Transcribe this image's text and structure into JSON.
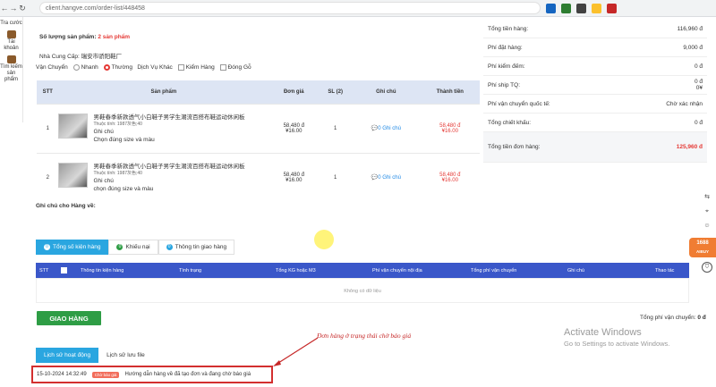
{
  "browser": {
    "url": "client.hangve.com/order-list/448458"
  },
  "sidebar": {
    "items": [
      {
        "label": "Tra cước"
      },
      {
        "label": "Tài khoản"
      },
      {
        "label": "Tìm kiếm sản phẩm"
      }
    ]
  },
  "order": {
    "qty_label": "Số lượng sản phẩm:",
    "qty_value": "2 sản phẩm",
    "supplier_label": "Nhà Cung Cấp:",
    "supplier_value": "瑞安市骄阳鞋厂",
    "shipping_label": "Vận Chuyển",
    "shipping_options": [
      "Nhanh",
      "Thường"
    ],
    "service_label": "Dịch Vụ Khác",
    "service_options": [
      "Kiểm Hàng",
      "Đóng Gỗ"
    ],
    "note_label": "Ghi chú cho Hàng về:"
  },
  "products_table": {
    "headers": [
      "STT",
      "Sản phẩm",
      "Đơn giá",
      "SL (2)",
      "Ghi chú",
      "Thành tiền"
    ],
    "rows": [
      {
        "stt": "1",
        "name": "男鞋春季新款透气小白鞋子男学生潮流百搭布鞋运动休闲板",
        "attr": "Thuộc tính: 1987灰色;40",
        "note": "Ghi chú",
        "link": "Chọn đúng size và màu",
        "price_vnd": "58,480 đ",
        "price_cny": "¥16.00",
        "qty": "1",
        "note_btn": "0 Ghi chú",
        "total_vnd": "58,480 đ",
        "total_cny": "¥16.00"
      },
      {
        "stt": "2",
        "name": "男鞋春季新款透气小白鞋子男学生潮流百搭布鞋运动休闲板",
        "attr": "Thuộc tính: 1987灰色;40",
        "note": "Ghi chú",
        "link": "chọn đúng size và màu",
        "price_vnd": "58,480 đ",
        "price_cny": "¥16.00",
        "qty": "1",
        "note_btn": "0 Ghi chú",
        "total_vnd": "58,480 đ",
        "total_cny": "¥16.00"
      }
    ]
  },
  "summary": {
    "rows": [
      {
        "label": "Tổng tiền hàng:",
        "value": "116,960 đ"
      },
      {
        "label": "Phí đặt hàng:",
        "value": "9,000 đ"
      },
      {
        "label": "Phí kiểm đếm:",
        "value": "0 đ"
      },
      {
        "label": "Phí ship TQ:",
        "value": "0 đ",
        "value2": "0¥"
      },
      {
        "label": "Phí vận chuyển quốc tế:",
        "value": "Chờ xác nhận"
      },
      {
        "label": "Tổng chiết khấu:",
        "value": "0 đ"
      }
    ],
    "total_label": "Tổng tiền đơn hàng:",
    "total_value": "125,960 đ"
  },
  "tabs1": [
    {
      "count": "0",
      "label": "Tổng số kiện hàng"
    },
    {
      "count": "0",
      "label": "Khiếu nại"
    },
    {
      "count": "0",
      "label": "Thông tin giao hàng"
    }
  ],
  "packages_table": {
    "headers": [
      "STT",
      "Thông tin kiện hàng",
      "Tình trạng",
      "Tổng KG hoặc M3",
      "Phí vận chuyển nội địa",
      "Tổng phí vận chuyển",
      "Ghi chú",
      "Thao tác"
    ],
    "empty": "Không có dữ liệu"
  },
  "deliver_button": "GIAO HÀNG",
  "shipping_total": {
    "label": "Tổng phí vận chuyển:",
    "value": "0 đ"
  },
  "tabs2": [
    "Lịch sử hoạt động",
    "Lịch sử lưu file"
  ],
  "history": {
    "time": "15-10-2024 14:32:49",
    "status": "Chờ báo giá",
    "text": "Hướng dẫn hàng về đã tạo đơn và đang chờ báo giá"
  },
  "annotation": "Đơn hàng ở trạng thái chờ báo giá",
  "watermark": {
    "line1": "Activate Windows",
    "line2": "Go to Settings to activate Windows."
  },
  "floating": {
    "label1688": "1688",
    "sub1688": "AIBUY"
  },
  "colors": {
    "accent_blue": "#2aa6e0",
    "header_blue": "#3a57c9",
    "green": "#2e9d45",
    "red": "#e53935"
  }
}
